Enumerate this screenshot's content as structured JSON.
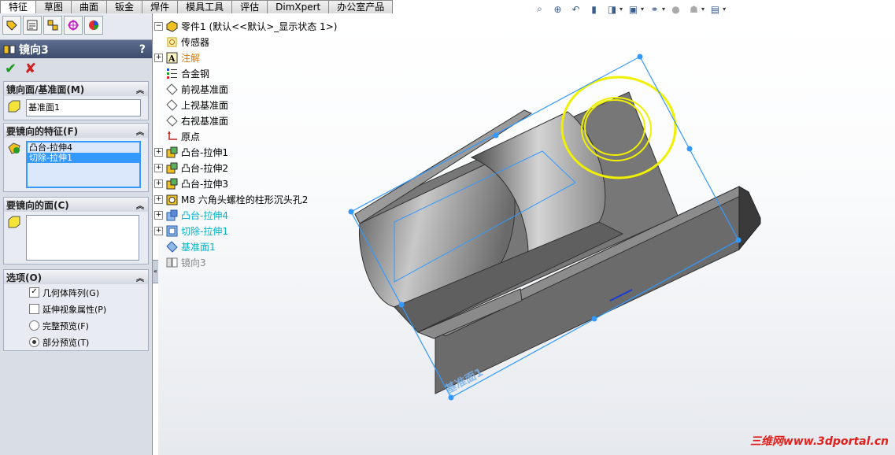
{
  "tabs": [
    "特征",
    "草图",
    "曲面",
    "钣金",
    "焊件",
    "模具工具",
    "评估",
    "DimXpert",
    "办公室产品"
  ],
  "property_manager": {
    "title": "镜向3",
    "help": "?",
    "ok": "✔",
    "cancel": "✘",
    "mirror_face": {
      "header": "镜向面/基准面(M)",
      "value": "基准面1"
    },
    "features": {
      "header": "要镜向的特征(F)",
      "items": [
        "凸台-拉伸4",
        "切除-拉伸1"
      ]
    },
    "faces": {
      "header": "要镜向的面(C)"
    },
    "options": {
      "header": "选项(O)",
      "geometry_pattern": "几何体阵列(G)",
      "propagate_visual": "延伸视象属性(P)",
      "full_preview": "完整预览(F)",
      "partial_preview": "部分预览(T)"
    }
  },
  "tree": {
    "root": "零件1  (默认<<默认>_显示状态 1>)",
    "items": [
      "传感器",
      "注解",
      "合金钢",
      "前视基准面",
      "上视基准面",
      "右视基准面",
      "原点",
      "凸台-拉伸1",
      "凸台-拉伸2",
      "凸台-拉伸3",
      "M8 六角头螺栓的柱形沉头孔2",
      "凸台-拉伸4",
      "切除-拉伸1",
      "基准面1",
      "镜向3"
    ]
  },
  "viewport": {
    "plane_label": "基准面1",
    "watermark": "三维网www.3dportal.cn"
  },
  "colors": {
    "accent": "#3399ff",
    "selection_cyan": "#00b4c8",
    "highlight_yellow": "#f0f000",
    "annotation_orange": "#e07a00"
  }
}
